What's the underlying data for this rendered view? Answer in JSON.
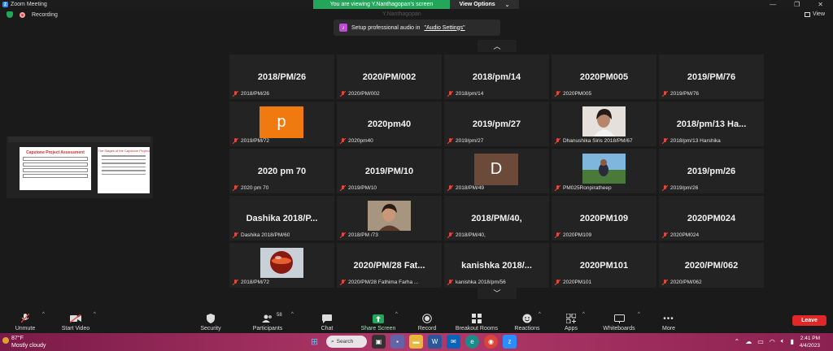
{
  "titlebar": {
    "title": "Zoom Meeting",
    "logo": "Z",
    "share_banner": "You are viewing Y.Nanthagopan's screen",
    "view_options": "View Options",
    "view_options_caret": "⌄"
  },
  "status": {
    "recording": "Recording",
    "view": "View",
    "presenter_name": "Y.Nanthagopan"
  },
  "audio_tip": {
    "text": "Setup professional audio in",
    "link": "\"Audio Settings\""
  },
  "pager": {
    "up": "︿",
    "down": "﹀"
  },
  "tiles": [
    {
      "big": "2018/PM/26",
      "small": "2018/PM/26"
    },
    {
      "big": "2020/PM/002",
      "small": "2020/PM/002"
    },
    {
      "big": "2018/pm/14",
      "small": "2018/pm/14"
    },
    {
      "big": "2020PM005",
      "small": "2020PM005"
    },
    {
      "big": "2019/PM/76",
      "small": "2019/PM/76"
    },
    {
      "letter": "p",
      "color": "#f07a10",
      "small": "2019/PM/72"
    },
    {
      "big": "2020pm40",
      "small": "2020pm40"
    },
    {
      "big": "2019/pm/27",
      "small": "2019/pm/27"
    },
    {
      "photo": "portrait",
      "small": "Dhanushika Siris 2018/PM/67"
    },
    {
      "big": "2018/pm/13  Ha...",
      "small": "2018/pm/13 Harshika"
    },
    {
      "big": "2020 pm 70",
      "small": "2020 pm 70"
    },
    {
      "big": "2019/PM/10",
      "small": "2019/PM/10"
    },
    {
      "letter": "D",
      "color": "#6b4a3a",
      "small": "2018/PM/49"
    },
    {
      "photo": "landscape",
      "small": "PM025Ronpiratheep"
    },
    {
      "big": "2019/pm/26",
      "small": "2019/pm/26"
    },
    {
      "big": "Dashika  2018/P...",
      "small": "Dashika 2018/PM/60"
    },
    {
      "photo": "selfie",
      "small": "2018/PM /73"
    },
    {
      "big": "2018/PM/40,",
      "small": "2018/PM/40,"
    },
    {
      "big": "2020PM109",
      "small": "2020PM109"
    },
    {
      "big": "2020PM024",
      "small": "2020PM024"
    },
    {
      "photo": "ball",
      "small": "2018/PM/72"
    },
    {
      "big": "2020/PM/28  Fat...",
      "small": "2020/PM/28 Fathima Farha ..."
    },
    {
      "big": "kanishka  2018/...",
      "small": "kanishka 2018/pm/56"
    },
    {
      "big": "2020PM101",
      "small": "2020PM101"
    },
    {
      "big": "2020/PM/062",
      "small": "2020/PM/062"
    }
  ],
  "shared_thumb": {
    "slide_title": "Capstone Project Assessment",
    "side_title": "The Stages of the Capstone Project"
  },
  "toolbar": {
    "unmute": "Unmute",
    "start_video": "Start Video",
    "security": "Security",
    "participants": "Participants",
    "participants_count": "58",
    "chat": "Chat",
    "share_screen": "Share Screen",
    "record": "Record",
    "breakout_rooms": "Breakout Rooms",
    "reactions": "Reactions",
    "apps": "Apps",
    "whiteboards": "Whiteboards",
    "more": "More",
    "leave": "Leave"
  },
  "taskbar": {
    "temp": "87°F",
    "weather": "Mostly cloudy",
    "search": "Search",
    "time": "2:41 PM",
    "date": "4/4/2023"
  },
  "colors": {
    "accent_green": "#23a55a",
    "leave_red": "#e02828",
    "mic_muted": "#e8453c"
  }
}
